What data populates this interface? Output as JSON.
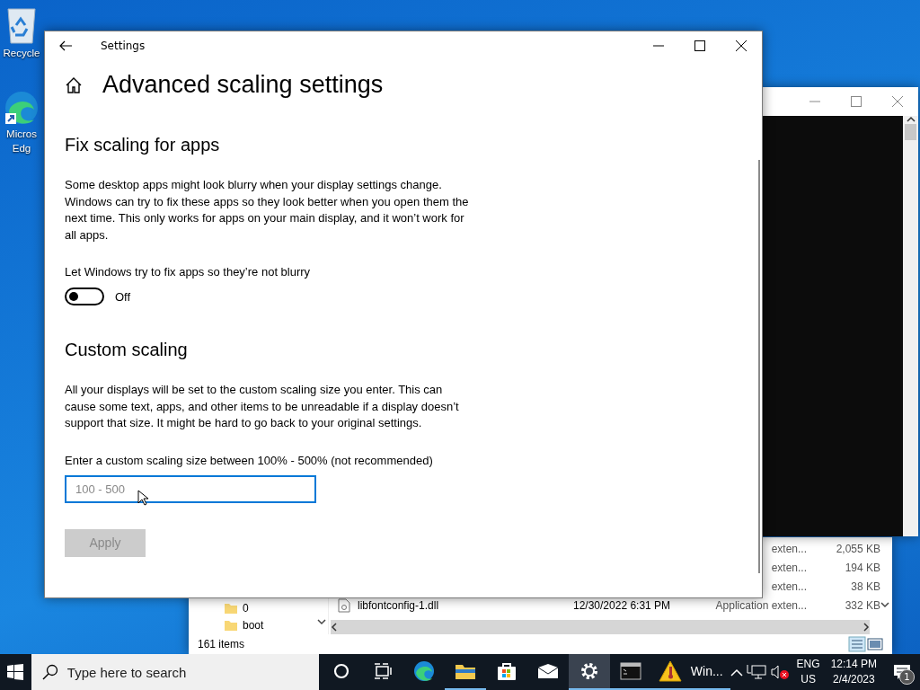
{
  "desktop_icons": [
    {
      "kind": "bin",
      "lines": [
        "Recycle"
      ]
    },
    {
      "kind": "edge",
      "lines": [
        "Micros",
        "Edg"
      ]
    }
  ],
  "explorer": {
    "tree": [
      {
        "label": "0"
      },
      {
        "label": "boot"
      }
    ],
    "rows": [
      {
        "type": "exten...",
        "size": "2,055 KB"
      },
      {
        "type": "exten...",
        "size": "194 KB"
      },
      {
        "type": "exten...",
        "size": "38 KB"
      },
      {
        "name": "libfontconfig-1.dll",
        "date": "12/30/2022 6:31 PM",
        "type": "Application exten...",
        "size": "332 KB"
      }
    ],
    "status": "161 items"
  },
  "settings": {
    "title": "Settings",
    "heading": "Advanced scaling settings",
    "sections": [
      {
        "kind": "toggle",
        "title": "Fix scaling for apps",
        "description": "Some desktop apps might look blurry when your display settings change. Windows can try to fix these apps so they look better when you open them the next time. This only works for apps on your main display, and it won’t work for all apps.",
        "label": "Let Windows try to fix apps so they’re not blurry",
        "toggle": {
          "on": false,
          "state_text": "Off"
        }
      },
      {
        "kind": "input",
        "title": "Custom scaling",
        "description": "All your displays will be set to the custom scaling size you enter. This can cause some text, apps, and other items to be unreadable if a display doesn’t support that size. It might be hard to go back to your original settings.",
        "label": "Enter a custom scaling size between 100% - 500% (not recommended)",
        "placeholder": "100 - 500",
        "button": {
          "label": "Apply",
          "disabled": true
        }
      }
    ]
  },
  "taskbar": {
    "search_placeholder": "Type here to search",
    "apps": [
      {
        "kind": "cortana",
        "running": false,
        "active": false
      },
      {
        "kind": "taskview",
        "running": false,
        "active": false
      },
      {
        "kind": "edge",
        "running": false,
        "active": false
      },
      {
        "kind": "folder",
        "running": true,
        "active": false
      },
      {
        "kind": "store",
        "running": false,
        "active": false
      },
      {
        "kind": "mail",
        "running": false,
        "active": false
      },
      {
        "kind": "gear",
        "running": true,
        "active": true
      },
      {
        "kind": "terminal",
        "running": true,
        "active": false
      },
      {
        "kind": "warning",
        "running": true,
        "active": false,
        "label": "Win..."
      }
    ],
    "language": [
      "ENG",
      "US"
    ],
    "time": "12:14 PM",
    "date": "2/4/2023",
    "notification_count": "1"
  }
}
